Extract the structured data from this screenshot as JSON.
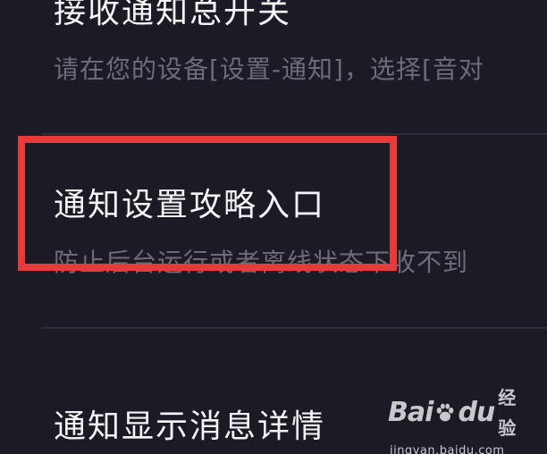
{
  "settings": {
    "items": [
      {
        "title": "接收通知总开关",
        "subtitle": "请在您的设备[设置-通知]，选择[音对"
      },
      {
        "title": "通知设置攻略入口",
        "subtitle": "防止后台运行或者离线状态下收不到"
      },
      {
        "title": "通知显示消息详情",
        "subtitle": ""
      }
    ]
  },
  "annotation": {
    "highlight_color": "#e8393b"
  },
  "watermark": {
    "brand_left": "Bai",
    "brand_right": "du",
    "brand_cn": "经验",
    "url": "jingyan.baidu.com"
  }
}
